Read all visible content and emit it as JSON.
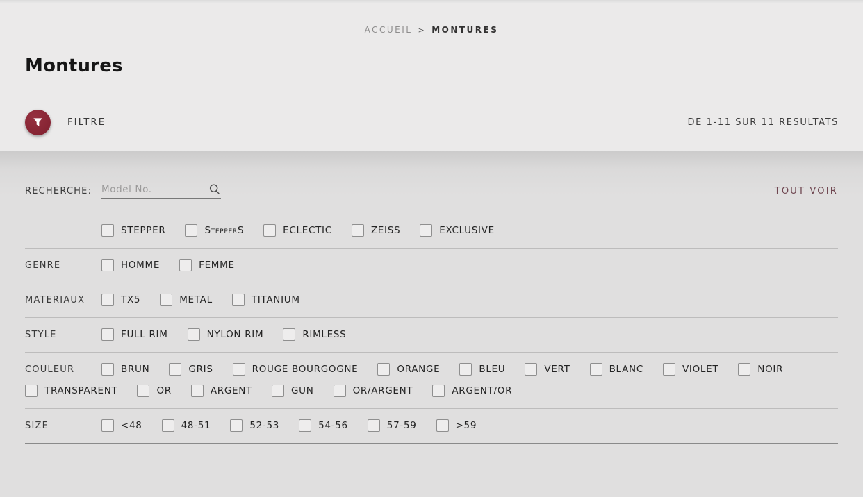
{
  "breadcrumb": {
    "separator": ">",
    "items": [
      {
        "label": "ACCUEIL"
      },
      {
        "label": "MONTURES"
      }
    ]
  },
  "header": {
    "title": "Montures",
    "filter_label": "FILTRE",
    "results_text": "DE 1-11 SUR 11 RESULTATS"
  },
  "search": {
    "label": "RECHERCHE:",
    "placeholder": "Model No.",
    "value": "",
    "see_all_label": "TOUT VOIR"
  },
  "filters": [
    {
      "name": "marques",
      "label": "",
      "options": [
        "STEPPER",
        "StepperS",
        "ECLECTIC",
        "ZEISS",
        "EXCLUSIVE"
      ],
      "checked": [
        false,
        false,
        false,
        false,
        false
      ]
    },
    {
      "name": "genre",
      "label": "GENRE",
      "options": [
        "HOMME",
        "FEMME"
      ],
      "checked": [
        false,
        false
      ]
    },
    {
      "name": "materiaux",
      "label": "MATERIAUX",
      "options": [
        "TX5",
        "METAL",
        "TITANIUM"
      ],
      "checked": [
        false,
        false,
        false
      ]
    },
    {
      "name": "style",
      "label": "STYLE",
      "options": [
        "FULL RIM",
        "NYLON RIM",
        "RIMLESS"
      ],
      "checked": [
        false,
        false,
        false
      ]
    },
    {
      "name": "couleur",
      "label": "COULEUR",
      "options": [
        "BRUN",
        "GRIS",
        "ROUGE BOURGOGNE",
        "ORANGE",
        "BLEU",
        "VERT",
        "BLANC",
        "VIOLET",
        "NOIR",
        "TRANSPARENT",
        "OR",
        "ARGENT",
        "GUN",
        "OR/ARGENT",
        "ARGENT/OR"
      ],
      "checked": [
        false,
        false,
        false,
        false,
        false,
        false,
        false,
        false,
        false,
        false,
        false,
        false,
        false,
        false,
        false
      ]
    },
    {
      "name": "size",
      "label": "SIZE",
      "options": [
        "<48",
        "48-51",
        "52-53",
        "54-56",
        "57-59",
        ">59"
      ],
      "checked": [
        false,
        false,
        false,
        false,
        false,
        false
      ]
    }
  ],
  "icons": {
    "filter": "funnel-icon",
    "search": "magnifier-icon"
  },
  "colors": {
    "accent_maroon": "#8b2433",
    "link_maroon": "#6f4650",
    "header_bg": "#ebeaea",
    "panel_bg": "#e0dfdf",
    "divider": "#bdbcbc",
    "dark_divider": "#8a8a8a"
  }
}
